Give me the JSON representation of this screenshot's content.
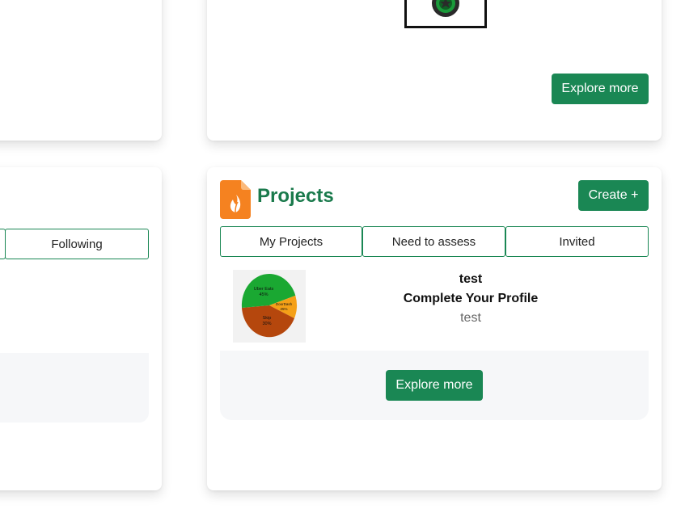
{
  "top_right_card": {
    "explore_label": "Explore more"
  },
  "left_bottom_card": {
    "tab_following": "Following"
  },
  "projects_card": {
    "title": "Projects",
    "create_label": "Create +",
    "tabs": [
      "My Projects",
      "Need to assess",
      "Invited"
    ],
    "project": {
      "name": "test",
      "status": "Complete Your Profile",
      "description": "test",
      "thumbnail_chart": {
        "type": "pie",
        "slices": [
          {
            "label": "Uber Eats",
            "value": 45,
            "color": "#1aa832"
          },
          {
            "label": "DoorDash",
            "value": 25,
            "color": "#f5a017"
          },
          {
            "label": "Skip",
            "value": 30,
            "color": "#b5470d"
          }
        ],
        "labels": [
          "Uber Eats",
          "45%",
          "DoorDash",
          "25%",
          "Skip",
          "30%"
        ]
      }
    },
    "explore_label": "Explore more"
  },
  "colors": {
    "accent": "#1a8754",
    "title": "#1a7a4c",
    "icon_orange": "#f58220"
  }
}
